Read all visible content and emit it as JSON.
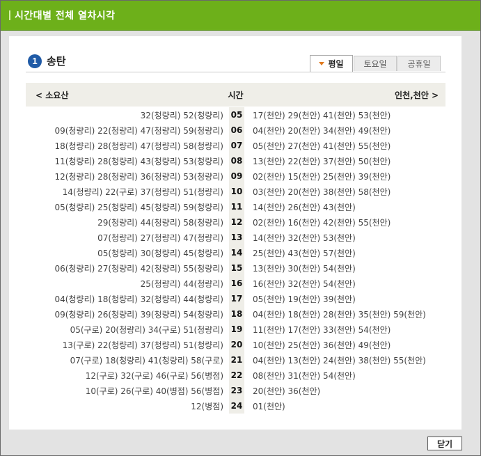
{
  "header": {
    "title": "시간대별 전체 열차시각"
  },
  "section": {
    "number": "1",
    "title": "송탄"
  },
  "tabs": [
    {
      "label": "평일",
      "active": true
    },
    {
      "label": "토요일",
      "active": false
    },
    {
      "label": "공휴일",
      "active": false
    }
  ],
  "table": {
    "left_header": "< 소요산",
    "center_header": "시간",
    "right_header": "인천,천안 >",
    "rows": [
      {
        "hour": "05",
        "left": "32(청량리) 52(청량리)",
        "right": "17(천안) 29(천안) 41(천안) 53(천안)"
      },
      {
        "hour": "06",
        "left": "09(청량리) 22(청량리) 47(청량리) 59(청량리)",
        "right": "04(천안) 20(천안) 34(천안) 49(천안)"
      },
      {
        "hour": "07",
        "left": "18(청량리) 28(청량리) 47(청량리) 58(청량리)",
        "right": "05(천안) 27(천안) 41(천안) 55(천안)"
      },
      {
        "hour": "08",
        "left": "11(청량리) 28(청량리) 43(청량리) 53(청량리)",
        "right": "13(천안) 22(천안) 37(천안) 50(천안)"
      },
      {
        "hour": "09",
        "left": "12(청량리) 28(청량리) 36(청량리) 53(청량리)",
        "right": "02(천안) 15(천안) 25(천안) 39(천안)"
      },
      {
        "hour": "10",
        "left": "14(청량리) 22(구로) 37(청량리) 51(청량리)",
        "right": "03(천안) 20(천안) 38(천안) 58(천안)"
      },
      {
        "hour": "11",
        "left": "05(청량리) 25(청량리) 45(청량리) 59(청량리)",
        "right": "14(천안) 26(천안) 43(천안)"
      },
      {
        "hour": "12",
        "left": "29(청량리) 44(청량리) 58(청량리)",
        "right": "02(천안) 16(천안) 42(천안) 55(천안)"
      },
      {
        "hour": "13",
        "left": "07(청량리) 27(청량리) 47(청량리)",
        "right": "14(천안) 32(천안) 53(천안)"
      },
      {
        "hour": "14",
        "left": "05(청량리) 30(청량리) 45(청량리)",
        "right": "25(천안) 43(천안) 57(천안)"
      },
      {
        "hour": "15",
        "left": "06(청량리) 27(청량리) 42(청량리) 55(청량리)",
        "right": "13(천안) 30(천안) 54(천안)"
      },
      {
        "hour": "16",
        "left": "25(청량리) 44(청량리)",
        "right": "16(천안) 32(천안) 54(천안)"
      },
      {
        "hour": "17",
        "left": "04(청량리) 18(청량리) 32(청량리) 44(청량리)",
        "right": "05(천안) 19(천안) 39(천안)"
      },
      {
        "hour": "18",
        "left": "09(청량리) 26(청량리) 39(청량리) 54(청량리)",
        "right": "04(천안) 18(천안) 28(천안) 35(천안) 59(천안)"
      },
      {
        "hour": "19",
        "left": "05(구로) 20(청량리) 34(구로) 51(청량리)",
        "right": "11(천안) 17(천안) 33(천안) 54(천안)"
      },
      {
        "hour": "20",
        "left": "13(구로) 22(청량리) 37(청량리) 51(청량리)",
        "right": "10(천안) 25(천안) 36(천안) 49(천안)"
      },
      {
        "hour": "21",
        "left": "07(구로) 18(청량리) 41(청량리) 58(구로)",
        "right": "04(천안) 13(천안) 24(천안) 38(천안) 55(천안)"
      },
      {
        "hour": "22",
        "left": "12(구로) 32(구로) 46(구로) 56(병점)",
        "right": "08(천안) 31(천안) 54(천안)"
      },
      {
        "hour": "23",
        "left": "10(구로) 26(구로) 40(병점) 56(병점)",
        "right": "20(천안) 36(천안)"
      },
      {
        "hour": "24",
        "left": "12(병점)",
        "right": "01(천안)"
      }
    ]
  },
  "footer": {
    "close_label": "닫기"
  }
}
